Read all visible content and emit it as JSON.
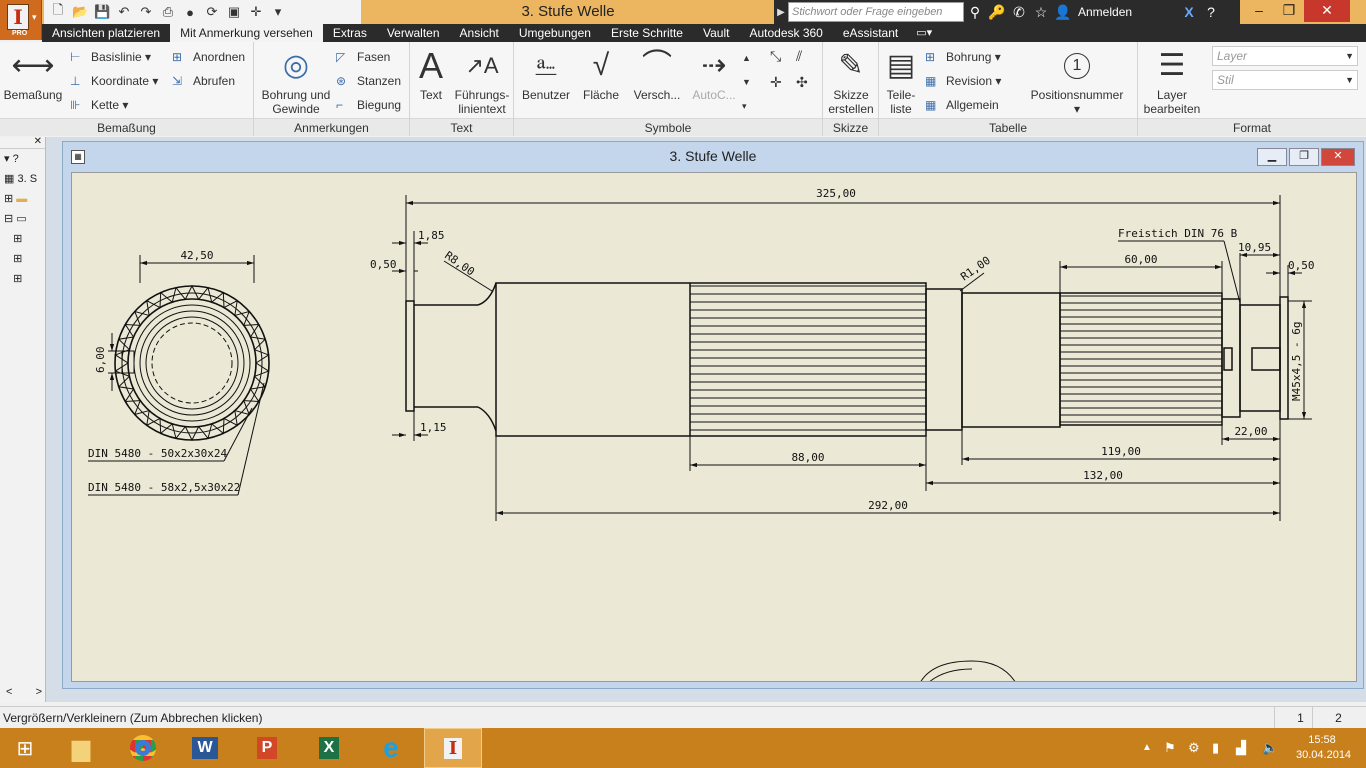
{
  "app": {
    "title": "3. Stufe Welle",
    "logo_letter": "I",
    "logo_edition": "PRO"
  },
  "search": {
    "placeholder": "Stichwort oder Frage eingeben"
  },
  "user": {
    "signin": "Anmelden"
  },
  "tabs": [
    "Ansichten platzieren",
    "Mit Anmerkung versehen",
    "Extras",
    "Verwalten",
    "Ansicht",
    "Umgebungen",
    "Erste Schritte",
    "Vault",
    "Autodesk 360",
    "eAssistant"
  ],
  "active_tab": "Mit Anmerkung versehen",
  "ribbon": {
    "bemassung": {
      "label": "Bemaßung",
      "big": "Bemaßung",
      "basislinie": "Basislinie",
      "koordinate": "Koordinate",
      "kette": "Kette",
      "anordnen": "Anordnen",
      "abrufen": "Abrufen"
    },
    "anmerkungen": {
      "label": "Anmerkungen",
      "bohrung_1": "Bohrung und",
      "bohrung_2": "Gewinde",
      "fasen": "Fasen",
      "stanzen": "Stanzen",
      "biegung": "Biegung"
    },
    "text": {
      "label": "Text",
      "text": "Text",
      "fuehrung_1": "Führungs-",
      "fuehrung_2": "linientext"
    },
    "symbole": {
      "label": "Symbole",
      "benutzer": "Benutzer",
      "flaeche": "Fläche",
      "versch": "Versch...",
      "autoc": "AutoC..."
    },
    "skizze": {
      "label": "Skizze",
      "skizze_1": "Skizze",
      "skizze_2": "erstellen"
    },
    "tabelle": {
      "label": "Tabelle",
      "teile_1": "Teile-",
      "teile_2": "liste",
      "bohrung": "Bohrung",
      "revision": "Revision",
      "allgemein": "Allgemein",
      "position": "Positionsnummer",
      "position_num": "1"
    },
    "format": {
      "label": "Format",
      "layer_1": "Layer",
      "layer_2": "bearbeiten",
      "layer_combo": "Layer",
      "stil_combo": "Stil"
    }
  },
  "browser": {
    "item": "3. S"
  },
  "drawing": {
    "dim_325": "325,00",
    "dim_185": "1,85",
    "dim_050_left": "0,50",
    "dim_r8": "R8,00",
    "dim_r1": "R1,00",
    "dim_115": "1,15",
    "dim_88": "88,00",
    "dim_292": "292,00",
    "dim_60": "60,00",
    "freistich": "Freistich DIN 76 B",
    "dim_1095": "10,95",
    "dim_050_right": "0,50",
    "thread": "M45x4,5 - 6g",
    "dim_22": "22,00",
    "dim_119": "119,00",
    "dim_132": "132,00",
    "dim_4250": "42,50",
    "dim_6": "6,00",
    "din1": "DIN 5480 - 50x2x30x24",
    "din2": "DIN 5480 - 58x2,5x30x22"
  },
  "status": {
    "message": "Vergrößern/Verkleinern (Zum Abbrechen klicken)",
    "page1": "1",
    "page2": "2"
  },
  "clock": {
    "time": "15:58",
    "date": "30.04.2014"
  },
  "colors": {
    "titlebar": "#ecb560",
    "taskbar": "#c8801d",
    "sheet": "#ebe8d6",
    "accent": "#d06a1c"
  }
}
